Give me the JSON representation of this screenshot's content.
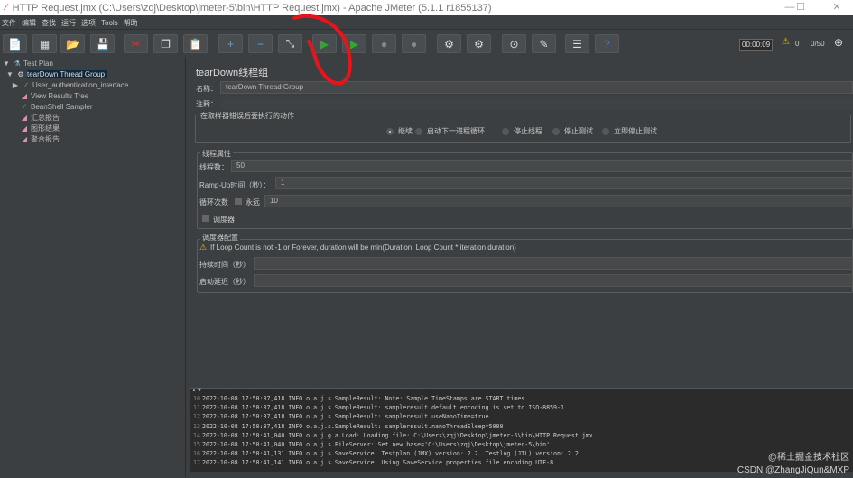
{
  "window": {
    "title": "HTTP Request.jmx (C:\\Users\\zqj\\Desktop\\jmeter-5\\bin\\HTTP Request.jmx) - Apache JMeter (5.1.1 r1855137)",
    "minimize": "—",
    "maximize": "☐",
    "close": "✕"
  },
  "menu": [
    "文件",
    "编辑",
    "查找",
    "运行",
    "选项",
    "Tools",
    "帮助"
  ],
  "toolbar": {
    "buttons": [
      {
        "name": "new",
        "icon": "📄"
      },
      {
        "name": "templates",
        "icon": "▦"
      },
      {
        "name": "open",
        "icon": "📂"
      },
      {
        "name": "save",
        "icon": "💾"
      },
      {
        "name": "cut",
        "icon": "✂"
      },
      {
        "name": "copy",
        "icon": "❐"
      },
      {
        "name": "paste",
        "icon": "📋"
      },
      {
        "name": "expand",
        "icon": "+"
      },
      {
        "name": "collapse",
        "icon": "−"
      },
      {
        "name": "toggle",
        "icon": "⤡"
      },
      {
        "name": "start",
        "icon": "▶"
      },
      {
        "name": "start-no-pauses",
        "icon": "▶"
      },
      {
        "name": "stop",
        "icon": "●"
      },
      {
        "name": "shutdown",
        "icon": "●"
      },
      {
        "name": "clear",
        "icon": "⚙"
      },
      {
        "name": "clear-all",
        "icon": "⚙"
      },
      {
        "name": "search",
        "icon": "⊙"
      },
      {
        "name": "reset-search",
        "icon": "✎"
      },
      {
        "name": "function-helper",
        "icon": "☰"
      },
      {
        "name": "help",
        "icon": "?"
      }
    ],
    "timer": "00:00:09",
    "warnings": "0",
    "threads": "0/50"
  },
  "tree": [
    {
      "label": "Test Plan",
      "icon": "flask",
      "expander": "▼"
    },
    {
      "label": "tearDown Thread Group",
      "icon": "gear",
      "expander": "▼",
      "selected": true
    },
    {
      "label": "User_authentication_interface",
      "icon": "pipette",
      "expander": "▶"
    },
    {
      "label": "View Results Tree",
      "icon": "chart",
      "expander": ""
    },
    {
      "label": "BeanShell Sampler",
      "icon": "pipette",
      "expander": ""
    },
    {
      "label": "汇总报告",
      "icon": "chart",
      "expander": ""
    },
    {
      "label": "图形结果",
      "icon": "chart",
      "expander": ""
    },
    {
      "label": "聚合报告",
      "icon": "chart",
      "expander": ""
    }
  ],
  "panel": {
    "title": "tearDown线程组",
    "name_label": "名称：",
    "name_value": "tearDown Thread Group",
    "comment_label": "注释：",
    "error_group": "在取样器错误后要执行的动作",
    "error_options": [
      {
        "label": "继续",
        "selected": true
      },
      {
        "label": "启动下一进程循环",
        "selected": false
      },
      {
        "label": "停止线程",
        "selected": false
      },
      {
        "label": "停止测试",
        "selected": false
      },
      {
        "label": "立即停止测试",
        "selected": false
      }
    ],
    "thread_group": "线程属性",
    "threads_label": "线程数：",
    "threads_value": "50",
    "rampup_label": "Ramp-Up时间（秒）：",
    "rampup_value": "1",
    "loop_label": "循环次数",
    "forever_label": "永远",
    "loop_value": "10",
    "scheduler_label": "调度器",
    "scheduler_group": "调度器配置",
    "warning": "If Loop Count is not -1 or Forever, duration will be min(Duration, Loop Count * iteration duration)",
    "duration_label": "持续时间（秒）",
    "delay_label": "启动延迟（秒）"
  },
  "log": {
    "lines": [
      {
        "n": "10",
        "text": "2022-10-08 17:50:37,418 INFO o.a.j.s.SampleResult: Note: Sample TimeStamps are START times"
      },
      {
        "n": "11",
        "text": "2022-10-08 17:50:37,418 INFO o.a.j.s.SampleResult: sampleresult.default.encoding is set to ISO-8859-1"
      },
      {
        "n": "12",
        "text": "2022-10-08 17:50:37,418 INFO o.a.j.s.SampleResult: sampleresult.useNanoTime=true"
      },
      {
        "n": "13",
        "text": "2022-10-08 17:50:37,418 INFO o.a.j.s.SampleResult: sampleresult.nanoThreadSleep=5000"
      },
      {
        "n": "14",
        "text": "2022-10-08 17:50:41,040 INFO o.a.j.g.a.Load: Loading file: C:\\Users\\zqj\\Desktop\\jmeter-5\\bin\\HTTP Request.jmx"
      },
      {
        "n": "15",
        "text": "2022-10-08 17:50:41,040 INFO o.a.j.s.FileServer: Set new base='C:\\Users\\zqj\\Desktop\\jmeter-5\\bin'"
      },
      {
        "n": "16",
        "text": "2022-10-08 17:50:41,131 INFO o.a.j.s.SaveService: Testplan (JMX) version: 2.2. Testlog (JTL) version: 2.2"
      },
      {
        "n": "17",
        "text": "2022-10-08 17:50:41,141 INFO o.a.j.s.SaveService: Using SaveService properties file encoding UTF-8"
      }
    ]
  },
  "watermark": {
    "line1": "@稀土掘金技术社区",
    "line2": "CSDN @ZhangJiQun&MXP"
  },
  "colors": {
    "annotation": "#e8141b",
    "selection": "#0d293e"
  }
}
